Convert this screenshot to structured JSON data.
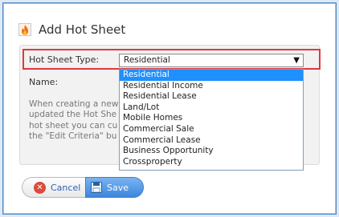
{
  "dialog": {
    "title": "Add Hot Sheet",
    "icon": "fire-icon"
  },
  "form": {
    "type_label": "Hot Sheet Type:",
    "name_label": "Name:",
    "selected_type": "Residential",
    "help_text": "When creating a new\nupdated the Hot She\nhot sheet you can cu\nthe \"Edit Criteria\" bu"
  },
  "dropdown": {
    "options": [
      "Residential",
      "Residential Income",
      "Residential Lease",
      "Land/Lot",
      "Mobile Homes",
      "Commercial Sale",
      "Commercial Lease",
      "Business Opportunity",
      "Crossproperty"
    ]
  },
  "buttons": {
    "cancel_label": "Cancel",
    "save_label": "Save"
  },
  "colors": {
    "highlight": "#e0393e",
    "selected_option": "#1e90ff",
    "save_button": "#3d86dd",
    "cancel_icon": "#d94b3e"
  }
}
